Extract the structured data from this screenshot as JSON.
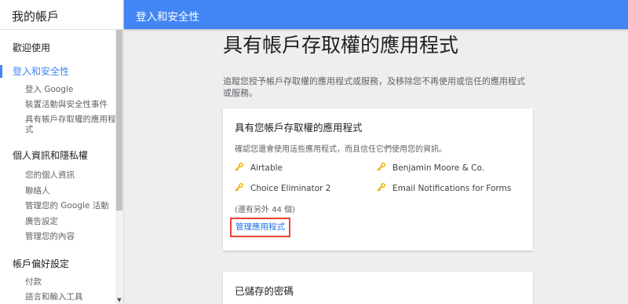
{
  "sidebar": {
    "title": "我的帳戶",
    "items": [
      {
        "label": "歡迎使用"
      },
      {
        "label": "登入和安全性"
      },
      {
        "label": "登入 Google"
      },
      {
        "label": "裝置活動與安全性事件"
      },
      {
        "label": "具有帳戶存取權的應用程式"
      },
      {
        "label": "個人資訊和隱私權"
      },
      {
        "label": "您的個人資訊"
      },
      {
        "label": "聯絡人"
      },
      {
        "label": "管理您的 Google 活動"
      },
      {
        "label": "廣告設定"
      },
      {
        "label": "管理您的內容"
      },
      {
        "label": "帳戶偏好設定"
      },
      {
        "label": "付款"
      },
      {
        "label": "語言和輸入工具"
      }
    ]
  },
  "header": {
    "title": "登入和安全性"
  },
  "main": {
    "title": "具有帳戶存取權的應用程式",
    "description": "追蹤您授予帳戶存取權的應用程式或服務，及移除您不再使用或信任的應用程式或服務。",
    "card": {
      "title": "具有您帳戶存取權的應用程式",
      "description": "確認您還會使用這些應用程式，而且信任它們使用您的資訊。",
      "apps": [
        {
          "name": "Airtable",
          "icon": "key-icon"
        },
        {
          "name": "Benjamin Moore & Co.",
          "icon": "key-icon"
        },
        {
          "name": "Choice Eliminator 2",
          "icon": "key-icon"
        },
        {
          "name": "Email Notifications for Forms",
          "icon": "key-icon"
        }
      ],
      "more": "(還有另外 44 個)",
      "manage_label": "管理應用程式"
    },
    "card2": {
      "title": "已儲存的密碼"
    }
  },
  "colors": {
    "accent": "#4285f4",
    "highlight": "#ea4335",
    "link": "#1a73e8",
    "key_icon": "#f4b400"
  }
}
